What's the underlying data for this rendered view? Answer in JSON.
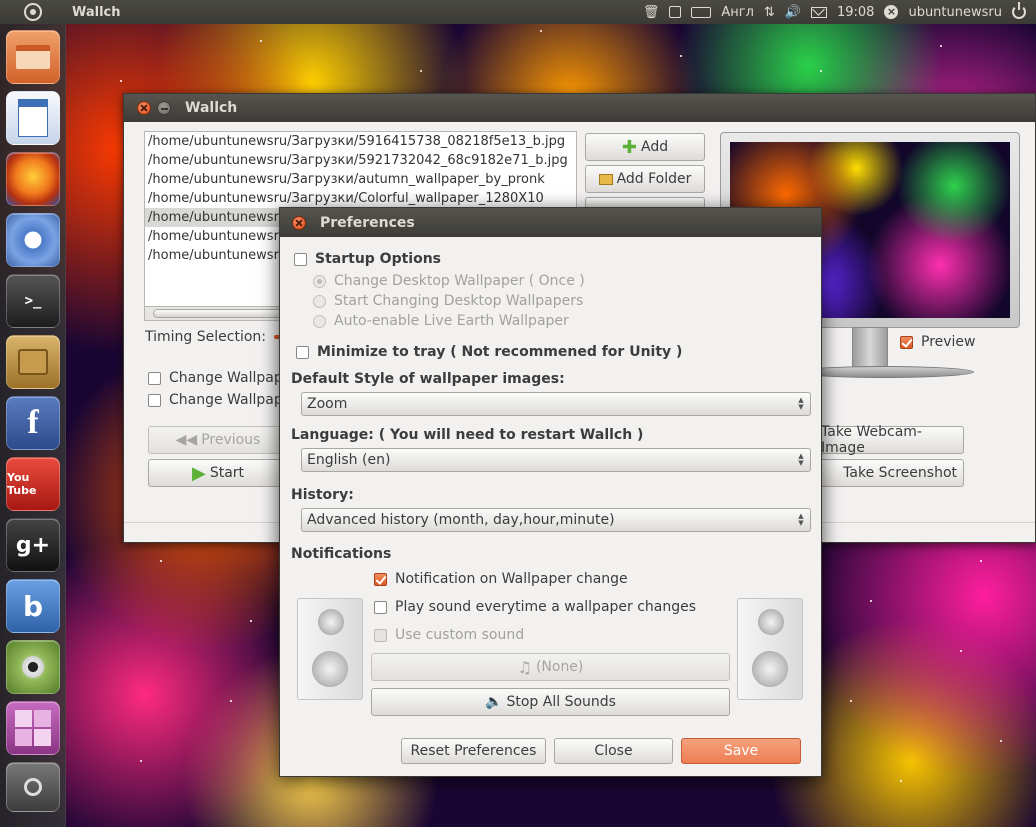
{
  "top_panel": {
    "app_title": "Wallch",
    "keyboard_layout": "Англ",
    "clock": "19:08",
    "user": "ubuntunewsru"
  },
  "launcher": {
    "items": [
      {
        "name": "home-folder-icon",
        "color": "#e0793d"
      },
      {
        "name": "libreoffice-writer-icon",
        "color": "#3c6fb5"
      },
      {
        "name": "firefox-icon",
        "color": "#e8681e"
      },
      {
        "name": "chromium-icon",
        "color": "#4c7bc9"
      },
      {
        "name": "terminal-icon",
        "color": "#2c2c2c"
      },
      {
        "name": "software-center-icon",
        "color": "#b9882f"
      },
      {
        "name": "facebook-icon",
        "color": "#3b5998"
      },
      {
        "name": "youtube-icon",
        "color": "#d8261e"
      },
      {
        "name": "google-plus-icon",
        "color": "#2e2e2e"
      },
      {
        "name": "beatbox-icon",
        "color": "#3f79c7"
      },
      {
        "name": "webcam-icon",
        "color": "#6d9a3a"
      },
      {
        "name": "workspace-switcher-icon",
        "color": "#a04a9a"
      },
      {
        "name": "magnifier-icon",
        "color": "#555555"
      }
    ],
    "labels": {
      "facebook": "f",
      "youtube": "You Tube",
      "gplus": "g+",
      "beatbox": "b"
    }
  },
  "wallch": {
    "title": "Wallch",
    "files": [
      "/home/ubuntunewsru/Загрузки/5916415738_08218f5e13_b.jpg",
      "/home/ubuntunewsru/Загрузки/5921732042_68c9182e71_b.jpg",
      "/home/ubuntunewsru/Загрузки/autumn_wallpaper_by_pronk",
      "/home/ubuntunewsru/Загрузки/Colorful_wallpaper_1280X10",
      "/home/ubuntunewsru/Загрузки/",
      "/home/ubuntunewsru/Загрузки/",
      "/home/ubuntunewsru/Загрузки/"
    ],
    "selected_index": 4,
    "add_label": "Add",
    "add_folder_label": "Add Folder",
    "timing_label": "Timing Selection:",
    "check1": "Change Wallpaper",
    "check2": "Change Wallpaper",
    "previous_label": "Previous",
    "start_label": "Start",
    "webcam_label": "Take Webcam-Image",
    "screenshot_label": "Take Screenshot",
    "preview_label": "Preview"
  },
  "prefs": {
    "title": "Preferences",
    "startup_options": "Startup Options",
    "radio1": "Change Desktop Wallpaper ( Once )",
    "radio2": "Start Changing Desktop Wallpapers",
    "radio3": "Auto-enable Live Earth Wallpaper",
    "minimize_tray": "Minimize to tray ( Not recommened for Unity )",
    "default_style_label": "Default Style of wallpaper images:",
    "default_style_value": "Zoom",
    "language_label": "Language: ( You will need to restart Wallch )",
    "language_value": "English (en)",
    "history_label": "History:",
    "history_value": "Advanced history (month, day,hour,minute)",
    "notifications_title": "Notifications",
    "notif1": "Notification on Wallpaper change",
    "notif2": "Play sound everytime a wallpaper changes",
    "notif3": "Use custom sound",
    "sound_none": "(None)",
    "stop_sounds": "Stop All Sounds",
    "reset_label": "Reset Preferences",
    "close_label": "Close",
    "save_label": "Save"
  }
}
